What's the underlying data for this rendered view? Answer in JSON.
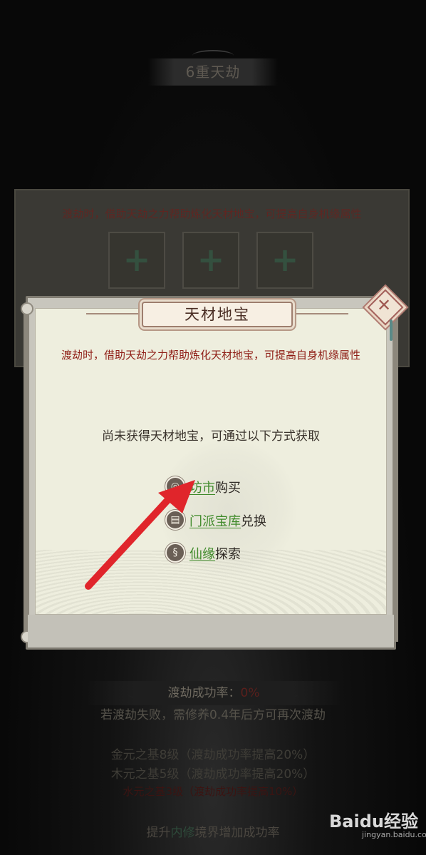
{
  "background": {
    "stage_title": "6重天劫",
    "panel_description": "渡劫时，借助天劫之力帮助炼化天材地宝，可提高自身机缘属性",
    "slots": [
      "+",
      "+",
      "+"
    ],
    "success_rate_label": "渡劫成功率：",
    "success_rate_value": "0%",
    "fail_note": "若渡劫失败，需修养0.4年后方可再次渡劫",
    "base_lines": [
      "金元之基8级（渡劫成功率提高20%）",
      "木元之基5级（渡劫成功率提高20%）",
      "水元之基3级（渡劫成功率提高10%）"
    ],
    "bottom_prefix": "提升",
    "bottom_link": "内修",
    "bottom_suffix": "境界增加成功率"
  },
  "modal": {
    "title": "天材地宝",
    "description": "渡劫时，借助天劫之力帮助炼化天材地宝，可提高自身机缘属性",
    "hint": "尚未获得天材地宝，可通过以下方式获取",
    "close_icon": "close-diamond-icon",
    "sources": [
      {
        "icon": "coin-pouch-icon",
        "glyph": "◎",
        "link": "坊市",
        "action": "购买"
      },
      {
        "icon": "sect-vault-icon",
        "glyph": "▤",
        "link": "门派宝库",
        "action": "兑换"
      },
      {
        "icon": "fortune-swirl-icon",
        "glyph": "§",
        "link": "仙缘",
        "action": "探索"
      }
    ]
  },
  "watermark": {
    "brand": "Baidu经验",
    "domain": "jingyan.baidu.com"
  },
  "colors": {
    "modal_bg": "#eeeede",
    "desc_red": "#8f1e16",
    "link_green": "#3f8a2a",
    "arrow_red": "#e0252b"
  }
}
